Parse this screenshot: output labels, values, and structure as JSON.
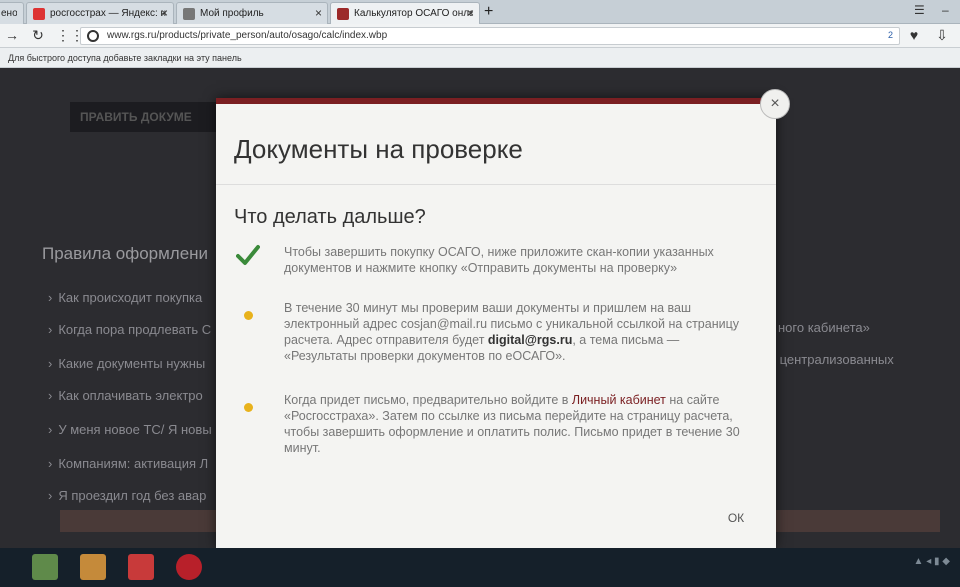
{
  "browser": {
    "tabs": [
      {
        "label": "ено"
      },
      {
        "label": "росгосстрах — Яндекс: н"
      },
      {
        "label": "Мой профиль"
      },
      {
        "label": "Калькулятор ОСАГО онла"
      }
    ],
    "url": "www.rgs.ru/products/private_person/auto/osago/calc/index.wbp",
    "url_badge": "2",
    "bookmarks_hint": "Для быстрого доступа добавьте закладки на эту панель"
  },
  "background_page": {
    "dark_button": "ПРАВИТЬ ДОКУМЕ",
    "section_title": "Правила оформлени",
    "faq": [
      "Как происходит покупка",
      "Когда пора продлевать С",
      "Какие документы нужны",
      "Как оплачивать электро",
      "У меня новое ТС/ Я новы",
      "Компаниям: активация Л",
      "Я проездил год без авар"
    ],
    "side_texts": [
      "ного кабинета»",
      "т централизованных"
    ]
  },
  "modal": {
    "title": "Документы на проверке",
    "subtitle": "Что делать дальше?",
    "step1": "Чтобы завершить покупку ОСАГО, ниже приложите скан-копии указанных документов и нажмите кнопку «Отправить документы на проверку»",
    "step2_a": "В течение 30 минут мы проверим ваши документы и пришлем на ваш электронный адрес cosjan@mail.ru письмо с уникальной ссылкой на страницу расчета. Адрес отправителя будет ",
    "step2_email": "digital@rgs.ru",
    "step2_b": ", а тема письма — «Результаты проверки документов по еОСАГО».",
    "step3_a": "Когда придет письмо, предварительно войдите в ",
    "step3_link": "Личный кабинет",
    "step3_b": " на сайте «Росгосстраха». Затем по ссылке из письма перейдите на страницу расчета, чтобы завершить оформление и оплатить полис. Письмо придет в течение 30 минут.",
    "ok_label": "ОК",
    "close_symbol": "×"
  },
  "colors": {
    "accent": "#7a1f22",
    "check": "#3a8a3a",
    "bullet": "#e8b21c"
  }
}
